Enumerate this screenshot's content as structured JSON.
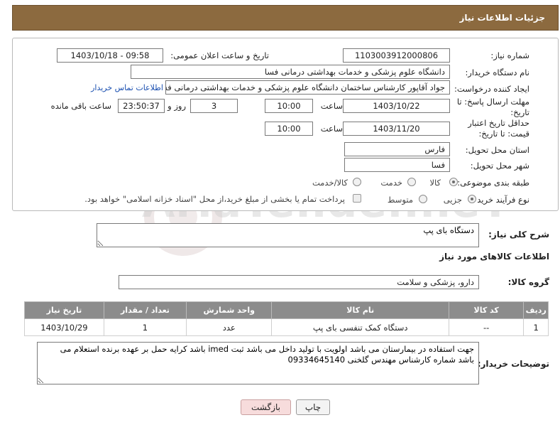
{
  "header": {
    "title": "جزئیات اطلاعات نیاز"
  },
  "form": {
    "need_number_label": "شماره نیاز:",
    "need_number": "1103003912000806",
    "announce_label": "تاریخ و ساعت اعلان عمومی:",
    "announce_value": "1403/10/18 - 09:58",
    "buyer_label": "نام دستگاه خریدار:",
    "buyer_value": "دانشگاه علوم پزشکی و خدمات بهداشتی درمانی فسا",
    "creator_label": "ایجاد کننده درخواست:",
    "creator_value": "جواد آقاپور کارشناس ساختمان دانشگاه علوم پزشکی و خدمات بهداشتی درمانی فسا",
    "contact_link": "اطلاعات تماس خریدار",
    "reply_deadline_label": "مهلت ارسال پاسخ: تا تاریخ:",
    "reply_date": "1403/10/22",
    "time_label": "ساعت",
    "reply_time": "10:00",
    "days_value": "3",
    "days_label": "روز و",
    "remaining_time": "23:50:37",
    "remaining_label": "ساعت باقی مانده",
    "price_validity_label": "حداقل تاریخ اعتبار قیمت: تا تاریخ:",
    "price_date": "1403/11/20",
    "price_time": "10:00",
    "province_label": "استان محل تحویل:",
    "province_value": "فارس",
    "city_label": "شهر محل تحویل:",
    "city_value": "فسا",
    "category_label": "طبقه بندی موضوعی:",
    "category_options": [
      "کالا",
      "خدمت",
      "کالا/خدمت"
    ],
    "category_selected": "کالا",
    "process_label": "نوع فرآیند خرید :",
    "process_options": [
      "جزیی",
      "متوسط"
    ],
    "process_selected": "جزیی",
    "payment_note": "پرداخت تمام یا بخشی از مبلغ خرید،از محل \"اسناد خزانه اسلامی\" خواهد بود."
  },
  "description": {
    "label": "شرح کلی نیاز:",
    "value": "دستگاه بای پپ"
  },
  "goods_info_title": "اطلاعات کالاهای مورد نیاز",
  "goods_group": {
    "label": "گروه کالا:",
    "value": "دارو، پزشکی و سلامت"
  },
  "table": {
    "headers": [
      "ردیف",
      "کد کالا",
      "نام کالا",
      "واحد شمارش",
      "تعداد / مقدار",
      "تاریخ نیاز"
    ],
    "rows": [
      [
        "1",
        "--",
        "دستگاه کمک تنفسی بای پپ",
        "عدد",
        "1",
        "1403/10/29"
      ]
    ]
  },
  "buyer_notes": {
    "label": "توضیحات خریدار:",
    "value": "جهت استفاده در بیمارستان می باشد اولویت با تولید داخل می باشد ثبت imed باشد کرایه حمل بر عهده برنده استعلام می باشد شماره کارشناس مهندس گلخنی 09334645140"
  },
  "buttons": {
    "print": "چاپ",
    "back": "بازگشت"
  },
  "watermark": {
    "text": "AriaTender.neT"
  },
  "colors": {
    "header_bg": "#8c6a3f",
    "table_header_bg": "#8c8c8c",
    "link": "#1a4fb0",
    "back_button_bg": "#f7dcdc"
  }
}
